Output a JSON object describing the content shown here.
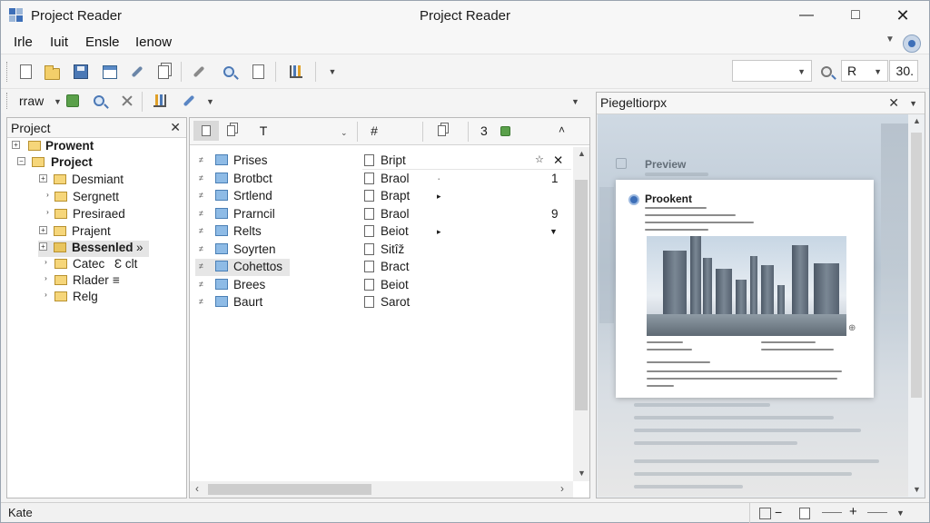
{
  "window": {
    "title_left": "Project Reader",
    "title_center": "Project Reader"
  },
  "menu": [
    "Irle",
    "Iuit",
    "Ensle",
    "Ienow"
  ],
  "toolbar1": {
    "search_combo_value": "",
    "zoom_combo_value": "R",
    "zoom_value": "30."
  },
  "toolbar2": {
    "view_label": "rraw"
  },
  "project_panel": {
    "title": "Project",
    "items": [
      {
        "label": "Prowent",
        "bold": true
      },
      {
        "label": "Project",
        "bold": true
      },
      {
        "label": "Desmiant"
      },
      {
        "label": "Sergnett"
      },
      {
        "label": "Presiraed"
      },
      {
        "label": "Prajent"
      },
      {
        "label": "Bessenled",
        "suffix": "»",
        "bold": true
      },
      {
        "label": "Catec",
        "suffix": "Ɛ clt"
      },
      {
        "label": "Rlader",
        "suffix": "≡"
      },
      {
        "label": "Relg"
      }
    ]
  },
  "middle_panel": {
    "count": "3",
    "folders": [
      "Prises",
      "Brotbct",
      "Srtlend",
      "Prarncil",
      "Relts",
      "Soyrten",
      "Cohettos",
      "Brees",
      "Baurt"
    ],
    "documents": [
      "Bript",
      "Braol",
      "Brapt",
      "Braol",
      "Beiot",
      "Sitîž",
      "Bract",
      "Beiot",
      "Sarot"
    ],
    "values": [
      "1",
      "9"
    ]
  },
  "preview_panel": {
    "title": "Piegeltiorpx",
    "header_text": "Preview",
    "card_title": "Prookent"
  },
  "statusbar": {
    "text": "Kate"
  },
  "colors": {
    "accent": "#3d6fb8",
    "folder_yellow": "#f6d67a",
    "folder_blue": "#8ebbe6"
  }
}
